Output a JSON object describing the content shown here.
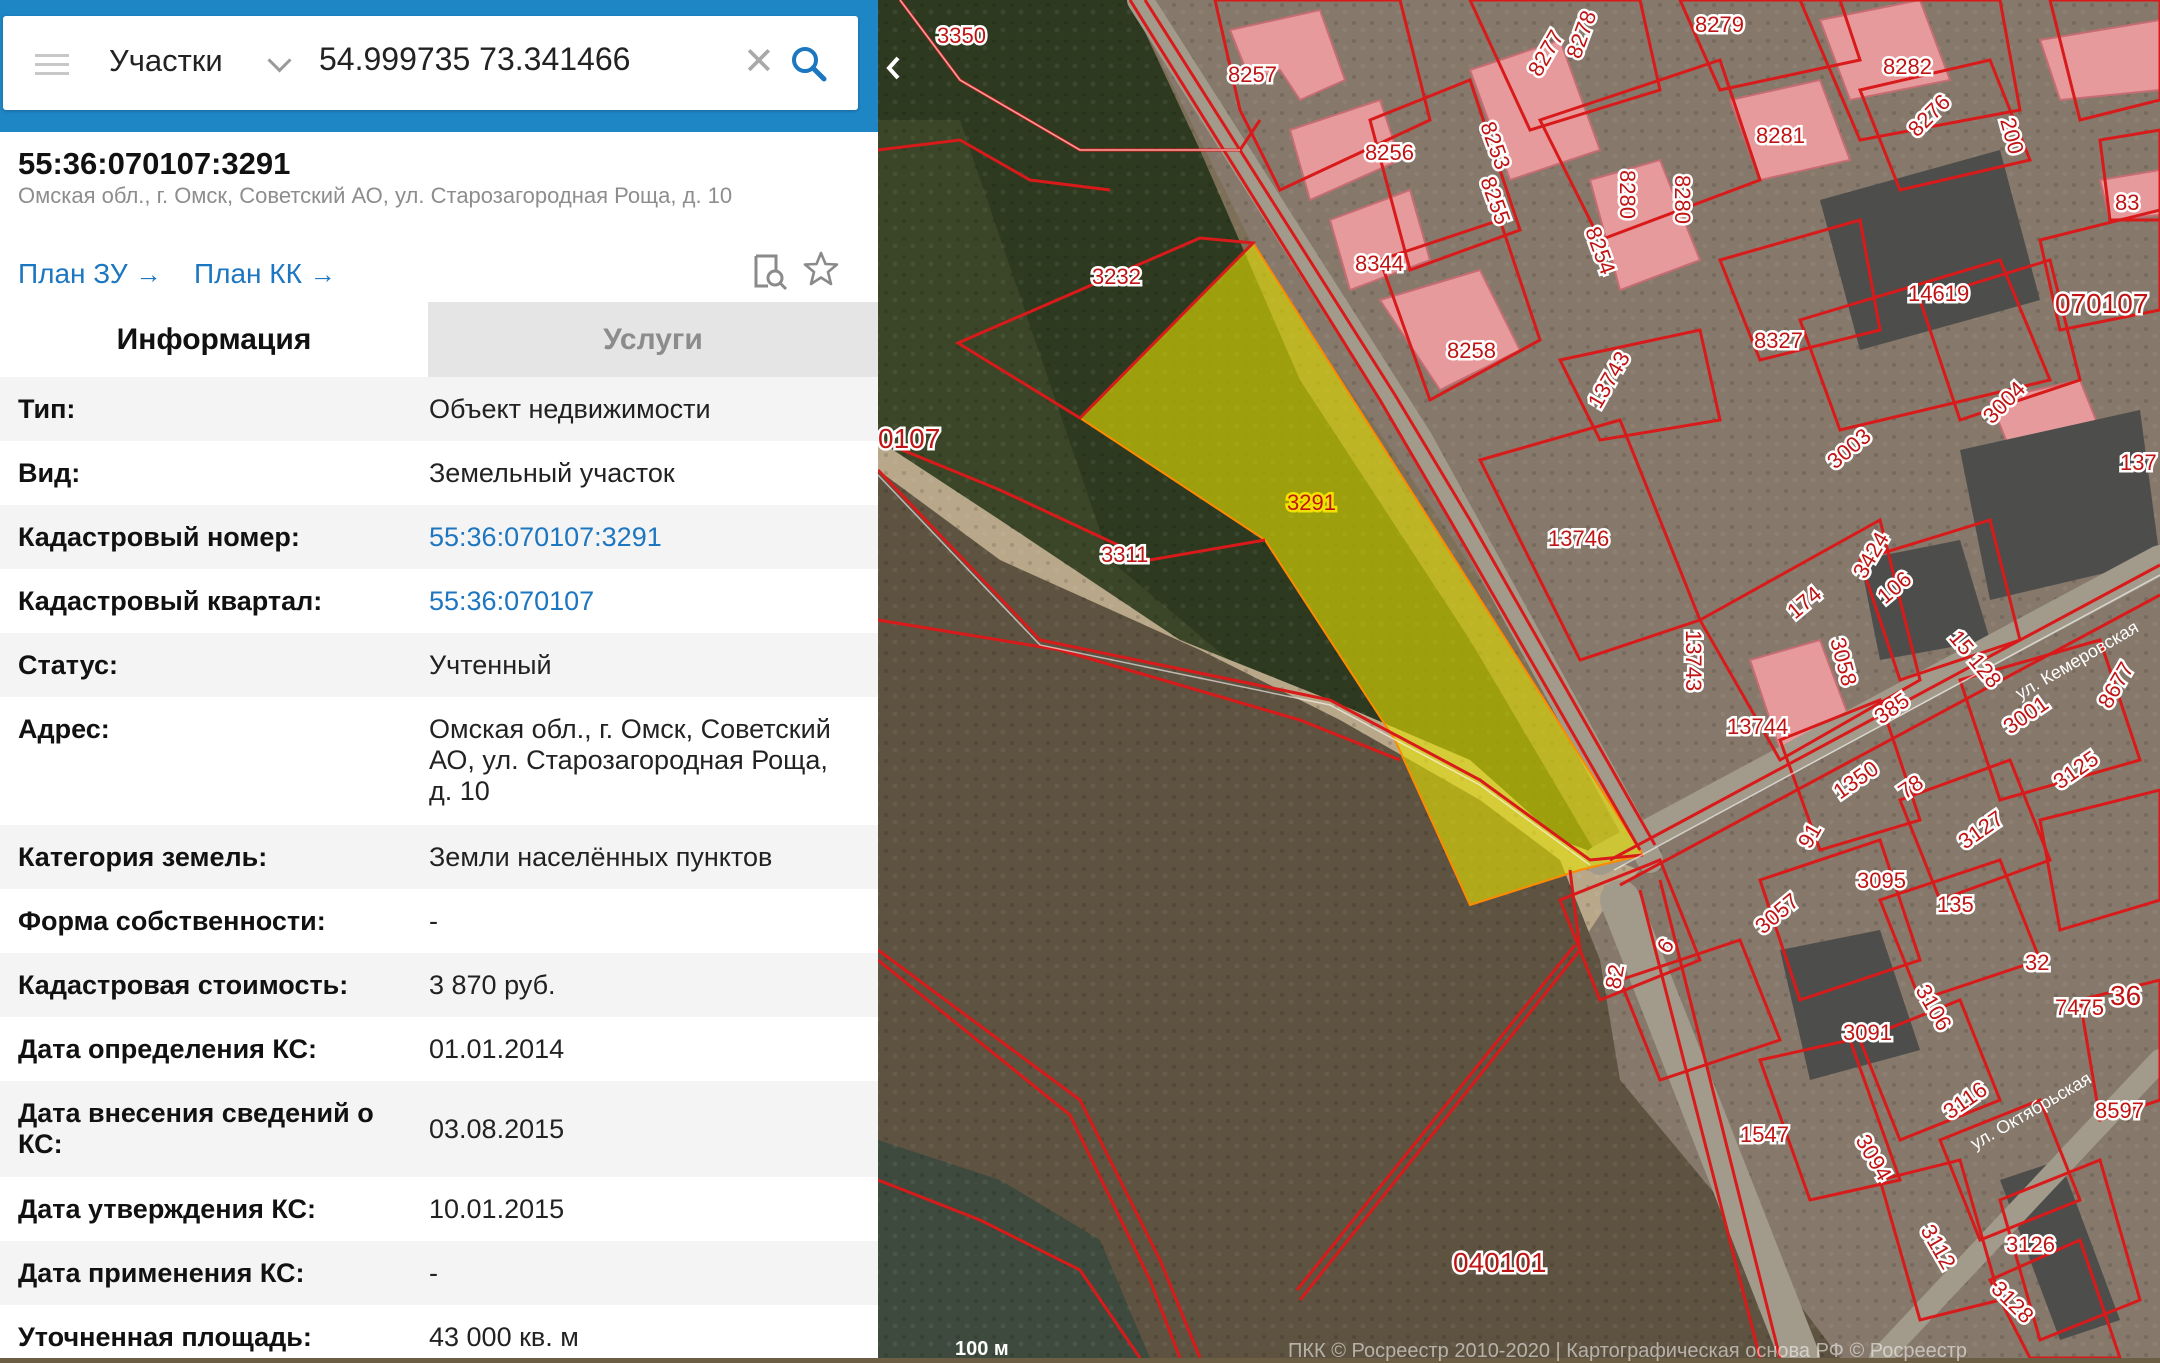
{
  "search": {
    "layer": "Участки",
    "query": "54.999735 73.341466"
  },
  "card": {
    "cad_number": "55:36:070107:3291",
    "address": "Омская обл., г. Омск, Советский АО, ул. Старозагородная Роща, д. 10",
    "plan_zu": "План ЗУ",
    "plan_kk": "План КК",
    "arrow": "→"
  },
  "tabs": {
    "info": "Информация",
    "services": "Услуги"
  },
  "info": [
    {
      "label": "Тип:",
      "value": "Объект недвижимости"
    },
    {
      "label": "Вид:",
      "value": "Земельный участок"
    },
    {
      "label": "Кадастровый номер:",
      "value": "55:36:070107:3291"
    },
    {
      "label": "Кадастровый квартал:",
      "value": "55:36:070107"
    },
    {
      "label": "Статус:",
      "value": "Учтенный"
    },
    {
      "label": "Адрес:",
      "value": "Омская обл., г. Омск, Советский АО, ул. Старозагородная Роща, д. 10"
    },
    {
      "label": "Категория земель:",
      "value": "Земли населённых пунктов"
    },
    {
      "label": "Форма собственности:",
      "value": "-"
    },
    {
      "label": "Кадастровая стоимость:",
      "value": "3 870 руб."
    },
    {
      "label": "Дата определения КС:",
      "value": "01.01.2014"
    },
    {
      "label": "Дата внесения сведений о КС:",
      "value": "03.08.2015"
    },
    {
      "label": "Дата утверждения КС:",
      "value": "10.01.2015"
    },
    {
      "label": "Дата применения КС:",
      "value": "-"
    },
    {
      "label": "Уточненная площадь:",
      "value": "43 000 кв. м"
    }
  ],
  "map": {
    "labels": {
      "l3350": "3350",
      "l8257": "8257",
      "l8256": "8256",
      "l8253": "8253",
      "l8277": "8277",
      "l8278": "8278",
      "l8279": "8279",
      "l8282": "8282",
      "l8281": "8281",
      "l8276": "8276",
      "l8255": "8255",
      "l8280a": "8280",
      "l8280b": "8280",
      "l8254": "8254",
      "l8344": "8344",
      "l8258": "8258",
      "l3232": "3232",
      "l3291": "3291",
      "l3311": "3311",
      "l0107": "0107",
      "l13743": "13743",
      "l13746": "13746",
      "l8327": "8327",
      "l14619": "14619",
      "l070107": "070107",
      "l3004": "3004",
      "l3003": "3003",
      "l3424": "3424",
      "l106": "106",
      "l174": "174",
      "l3058": "3058",
      "l15128": "15 128",
      "l13743b": "13743",
      "l13744": "13744",
      "l385": "385",
      "l3001": "3001",
      "l8677": "8677",
      "l3125": "3125",
      "l1350": "1350",
      "l78": "78",
      "l3127": "3127",
      "l3095": "3095",
      "l3057": "3057",
      "l135": "135",
      "l32": "32",
      "l7475": "7475",
      "l36": "36",
      "l3106": "3106",
      "l3091": "3091",
      "l8597": "8597",
      "l3116": "3116",
      "l1547": "1547",
      "l3094": "3094",
      "l040101": "040101",
      "l3112": "3112",
      "l3126": "3126",
      "l3128": "3128",
      "l6": "6",
      "l82": "82",
      "l200": "200",
      "l91": "91",
      "l83": "83",
      "l137": "137",
      "l30": "30"
    },
    "streets": {
      "st1": "ул. Кемеровская",
      "st2": "ул. Октябрьская"
    },
    "scale": "100 м",
    "attribution": "ПКК © Росреестр 2010-2020 | Картографическая основа РФ © Росреестр"
  },
  "colors": {
    "accent": "#1f86c6",
    "link": "#1c76c0",
    "boundary": "#d91a1a",
    "selected_fill": "#e8e400"
  }
}
